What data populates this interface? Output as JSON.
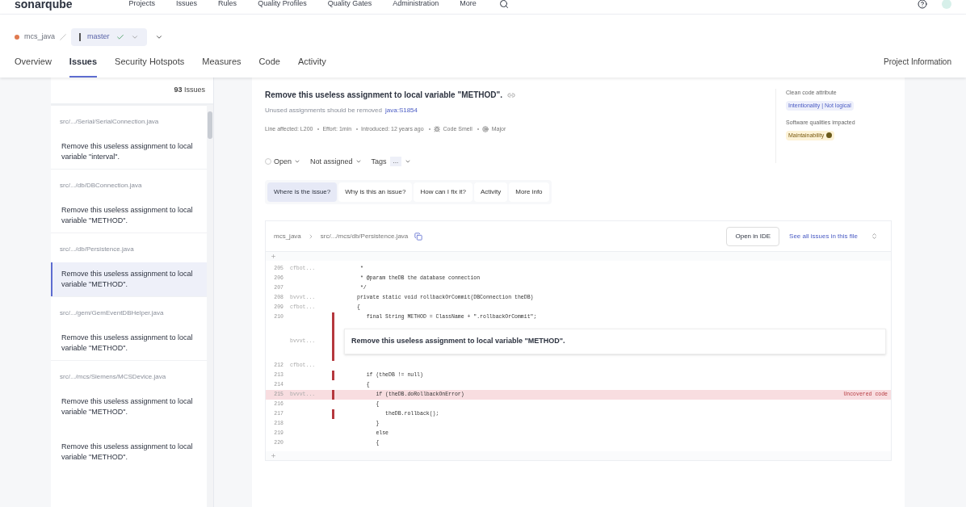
{
  "nav": {
    "logo": "sonarqube",
    "items": [
      "Projects",
      "Issues",
      "Rules",
      "Quality Profiles",
      "Quality Gates",
      "Administration",
      "More"
    ]
  },
  "breadcrumb": {
    "project": "mcs_java",
    "branch": "master"
  },
  "tabs": [
    {
      "label": "Overview",
      "selected": false
    },
    {
      "label": "Issues",
      "selected": true
    },
    {
      "label": "Security Hotspots",
      "selected": false
    },
    {
      "label": "Measures",
      "selected": false
    },
    {
      "label": "Code",
      "selected": false
    },
    {
      "label": "Activity",
      "selected": false
    }
  ],
  "project_information": "Project Information",
  "issue_count": {
    "number": "93",
    "label": "Issues"
  },
  "issues": [
    {
      "file": "src/.../Serial/SerialConnection.java",
      "message": "Remove this useless assignment to local variable \"interval\".",
      "selected": false
    },
    {
      "file": "src/.../db/DBConnection.java",
      "message": "Remove this useless assignment to local variable \"METHOD\".",
      "selected": false
    },
    {
      "file": "src/.../db/Persistence.java",
      "message": "Remove this useless assignment to local variable \"METHOD\".",
      "selected": true
    },
    {
      "file": "src/.../gem/GemEventDBHelper.java",
      "message": "Remove this useless assignment to local variable \"METHOD\".",
      "selected": false
    },
    {
      "file": "src/.../mcs/Siemens/MCSDevice.java",
      "message": "Remove this useless assignment to local variable \"METHOD\".",
      "selected": false
    },
    {
      "message": "Remove this useless assignment to local variable \"METHOD\".",
      "selected": false
    }
  ],
  "issue": {
    "title": "Remove this useless assignment to local variable \"METHOD\".",
    "subtitle": "Unused assignments should be removed",
    "rule": "java:S1854",
    "meta": [
      "Line affected: L200",
      "Effort: 1min",
      "Introduced: 12 years ago",
      "Code Smell",
      "Major"
    ],
    "status": "Open",
    "assignee": "Not assigned",
    "tag_label": "Tags",
    "tag": "..."
  },
  "attributes": {
    "clean_code_label": "Clean code attribute",
    "clean_code": "Intentionality | Not logical",
    "qualities_label": "Software qualities impacted",
    "quality": "Maintainability"
  },
  "detail_tabs": [
    {
      "label": "Where is the issue?",
      "selected": true
    },
    {
      "label": "Why is this an issue?",
      "selected": false
    },
    {
      "label": "How can I fix it?",
      "selected": false
    },
    {
      "label": "Activity",
      "selected": false
    },
    {
      "label": "More info",
      "selected": false
    }
  ],
  "source": {
    "project": "mcs_java",
    "path": "src/.../mcs/db/Persistence.java",
    "open_ide": "Open in IDE",
    "see_all": "See all issues in this file",
    "lines": [
      {
        "kind": "code",
        "number": "205",
        "author": "cfbot...",
        "code": " *",
        "marker": false,
        "uncovered": false
      },
      {
        "kind": "code",
        "number": "206",
        "code": " * @param theDB the database connection",
        "marker": false,
        "uncovered": false
      },
      {
        "kind": "code",
        "number": "207",
        "code": " */",
        "marker": false,
        "uncovered": false
      },
      {
        "kind": "code",
        "number": "208",
        "author": "bvvvt...",
        "code": "private static void rollbackOrCommit(DBConnection theDB)",
        "marker": false,
        "uncovered": false
      },
      {
        "kind": "code",
        "number": "209",
        "author": "cfbot...",
        "code": "{",
        "marker": false,
        "uncovered": false
      },
      {
        "kind": "code",
        "number": "210",
        "code": "   final String METHOD = ClassName + \".rollbackOrCommit\";",
        "marker": true,
        "uncovered": false
      },
      {
        "kind": "issue",
        "author": "bvvvt...",
        "message": "Remove this useless assignment to local variable \"METHOD\".",
        "marker": true
      },
      {
        "kind": "code",
        "number": "212",
        "author": "cfbot...",
        "marker": false,
        "uncovered": false
      },
      {
        "kind": "code",
        "number": "213",
        "code": "   if (theDB != null)",
        "marker": true,
        "uncovered": false
      },
      {
        "kind": "code",
        "number": "214",
        "code": "   {",
        "marker": false,
        "uncovered": false
      },
      {
        "kind": "code",
        "number": "215",
        "author": "bvvvt...",
        "code": "      if (theDB.doRollbackOnError)",
        "marker": true,
        "uncovered": true,
        "label": "Uncovered code"
      },
      {
        "kind": "code",
        "number": "216",
        "code": "      {",
        "marker": false,
        "uncovered": false
      },
      {
        "kind": "code",
        "number": "217",
        "code": "         theDB.rollback();",
        "marker": true,
        "uncovered": false
      },
      {
        "kind": "code",
        "number": "218",
        "code": "      }",
        "marker": false,
        "uncovered": false
      },
      {
        "kind": "code",
        "number": "219",
        "code": "      else",
        "marker": false,
        "uncovered": false
      },
      {
        "kind": "code",
        "number": "220",
        "code": "      {",
        "marker": false,
        "uncovered": false
      }
    ]
  }
}
